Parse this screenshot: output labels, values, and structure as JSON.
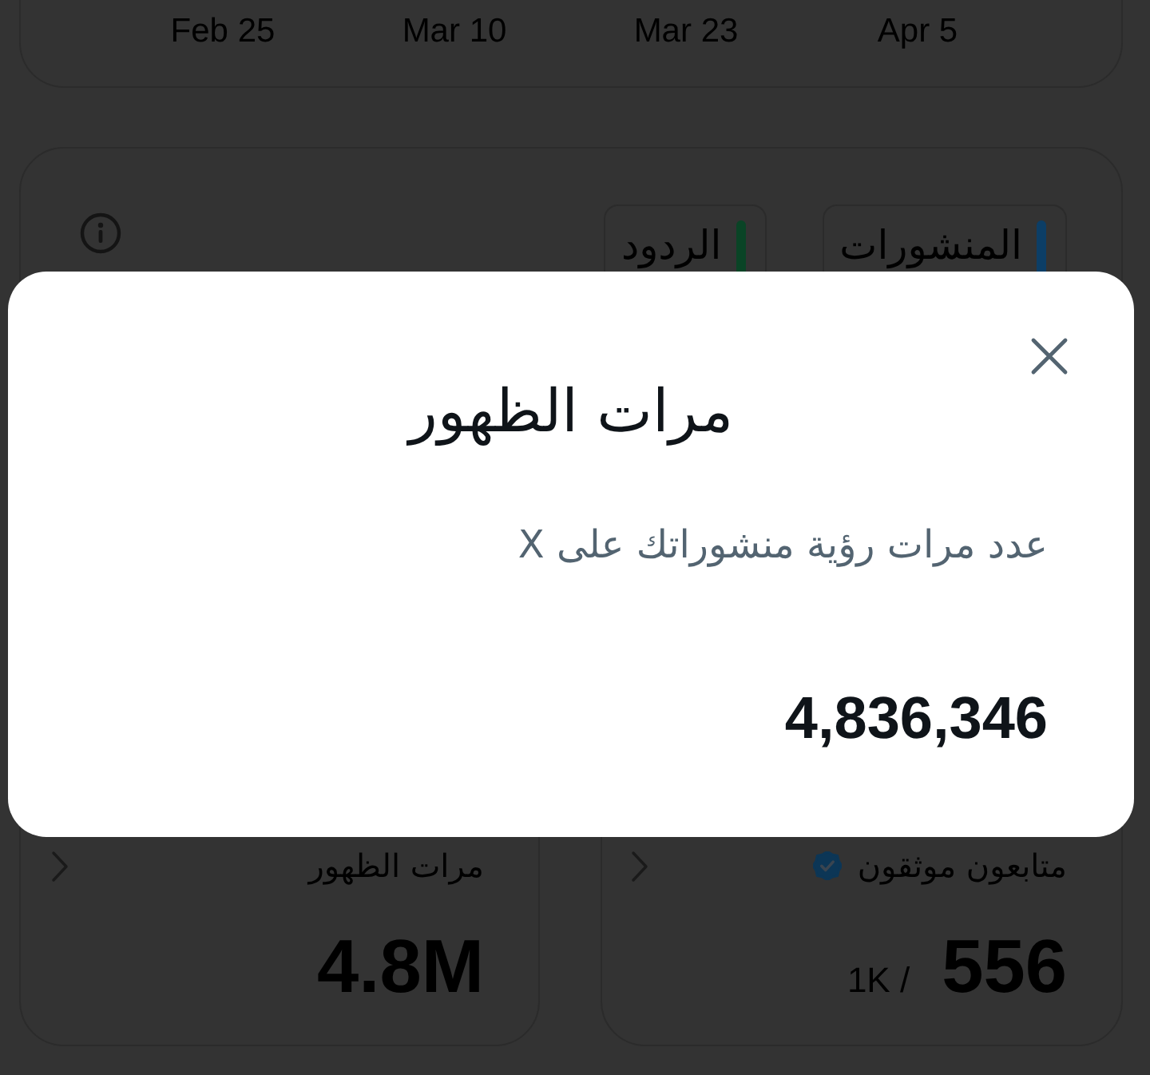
{
  "background": {
    "timeline": {
      "date_labels": [
        "Apr 5",
        "Mar 23",
        "Mar 10",
        "Feb 25"
      ]
    },
    "activity_card": {
      "legend": [
        {
          "label": "المنشورات",
          "color": "#0c3e66"
        },
        {
          "label": "الردود",
          "color": "#0a4426"
        }
      ]
    },
    "stat_cards": [
      {
        "kind": "verified",
        "label": "متابعون موثقون",
        "value": "556",
        "target": "1K /"
      },
      {
        "kind": "plain",
        "label": "مرات الظهور",
        "value": "4.8M"
      }
    ]
  },
  "dialog": {
    "title": "مرات الظهور",
    "description": "عدد مرات رؤية منشوراتك على X",
    "value": "4,836,346"
  }
}
